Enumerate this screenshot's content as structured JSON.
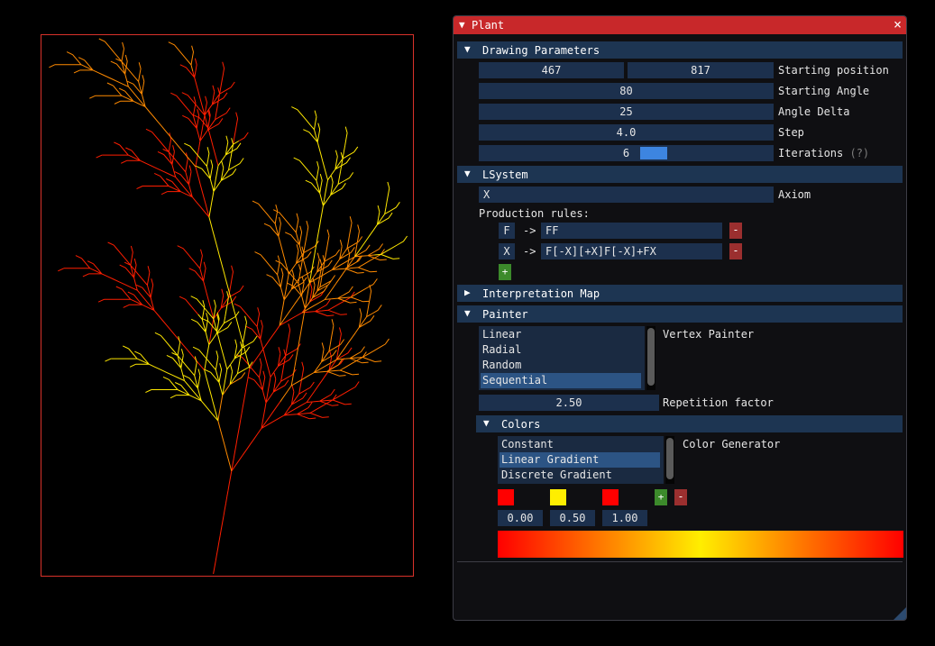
{
  "window": {
    "title": "Plant",
    "close_glyph": "×"
  },
  "drawing": {
    "header": "Drawing Parameters",
    "start_x": "467",
    "start_y": "817",
    "start_label": "Starting position",
    "angle": "80",
    "angle_label": "Starting Angle",
    "delta": "25",
    "delta_label": "Angle Delta",
    "step": "4.0",
    "step_label": "Step",
    "iterations": "6",
    "iterations_label": "Iterations",
    "iterations_help": "(?)",
    "iterations_slider_fraction": 0.16
  },
  "lsystem": {
    "header": "LSystem",
    "axiom": "X",
    "axiom_label": "Axiom",
    "rules_label": "Production rules:",
    "rules": [
      {
        "symbol": "F",
        "arrow": "->",
        "value": "FF"
      },
      {
        "symbol": "X",
        "arrow": "->",
        "value": "F[-X][+X]F[-X]+FX"
      }
    ],
    "remove_glyph": "-",
    "add_glyph": "+"
  },
  "interpretation": {
    "header": "Interpretation Map"
  },
  "painter": {
    "header": "Painter",
    "vertex_options": [
      "Linear",
      "Radial",
      "Random",
      "Sequential"
    ],
    "vertex_selected": "Sequential",
    "vertex_label": "Vertex Painter",
    "repetition": "2.50",
    "repetition_label": "Repetition factor",
    "colors": {
      "header": "Colors",
      "generators": [
        "Constant",
        "Linear Gradient",
        "Discrete Gradient"
      ],
      "generator_selected": "Linear Gradient",
      "generator_label": "Color Generator",
      "stops": [
        {
          "color": "#ff0000",
          "position": "0.00"
        },
        {
          "color": "#ffee00",
          "position": "0.50"
        },
        {
          "color": "#ff0000",
          "position": "1.00"
        }
      ]
    }
  },
  "plant": {
    "colors": [
      "#ff1e00",
      "#ff8a00",
      "#ffe800"
    ]
  }
}
